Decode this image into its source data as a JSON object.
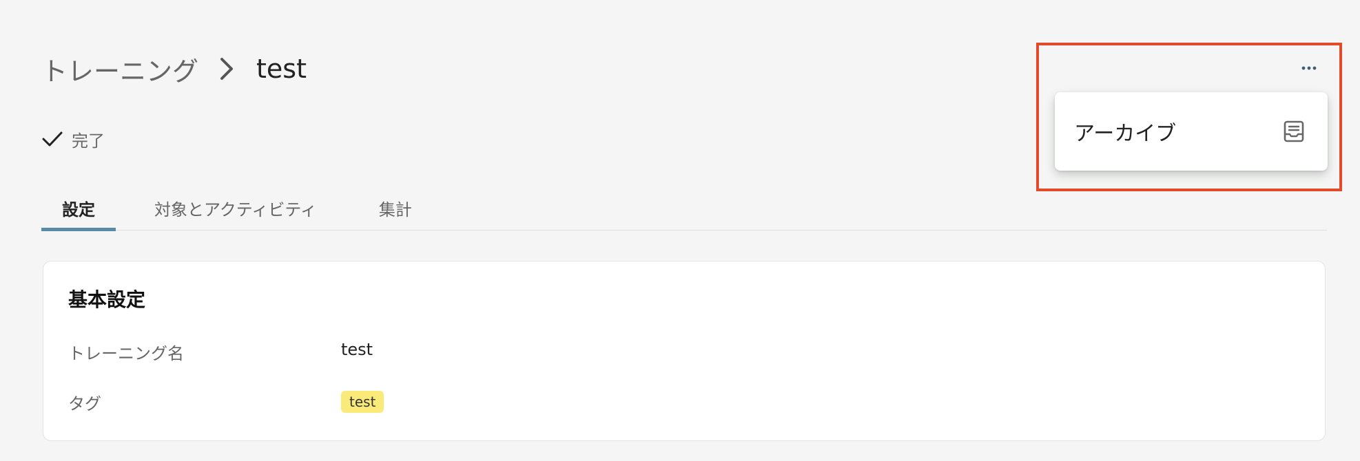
{
  "breadcrumb": {
    "parent": "トレーニング",
    "current": "test"
  },
  "status": {
    "text": "完了"
  },
  "tabs": [
    {
      "label": "設定",
      "active": true
    },
    {
      "label": "対象とアクティビティ",
      "active": false
    },
    {
      "label": "集計",
      "active": false
    }
  ],
  "card": {
    "title": "基本設定",
    "rows": [
      {
        "label": "トレーニング名",
        "value": "test"
      },
      {
        "label": "タグ",
        "value": "test"
      }
    ]
  },
  "menu": {
    "items": [
      {
        "label": "アーカイブ",
        "icon": "archive-icon"
      }
    ]
  },
  "colors": {
    "accent": "#5a8aa6",
    "highlight": "#e24a29",
    "tag": "#faea7a"
  }
}
